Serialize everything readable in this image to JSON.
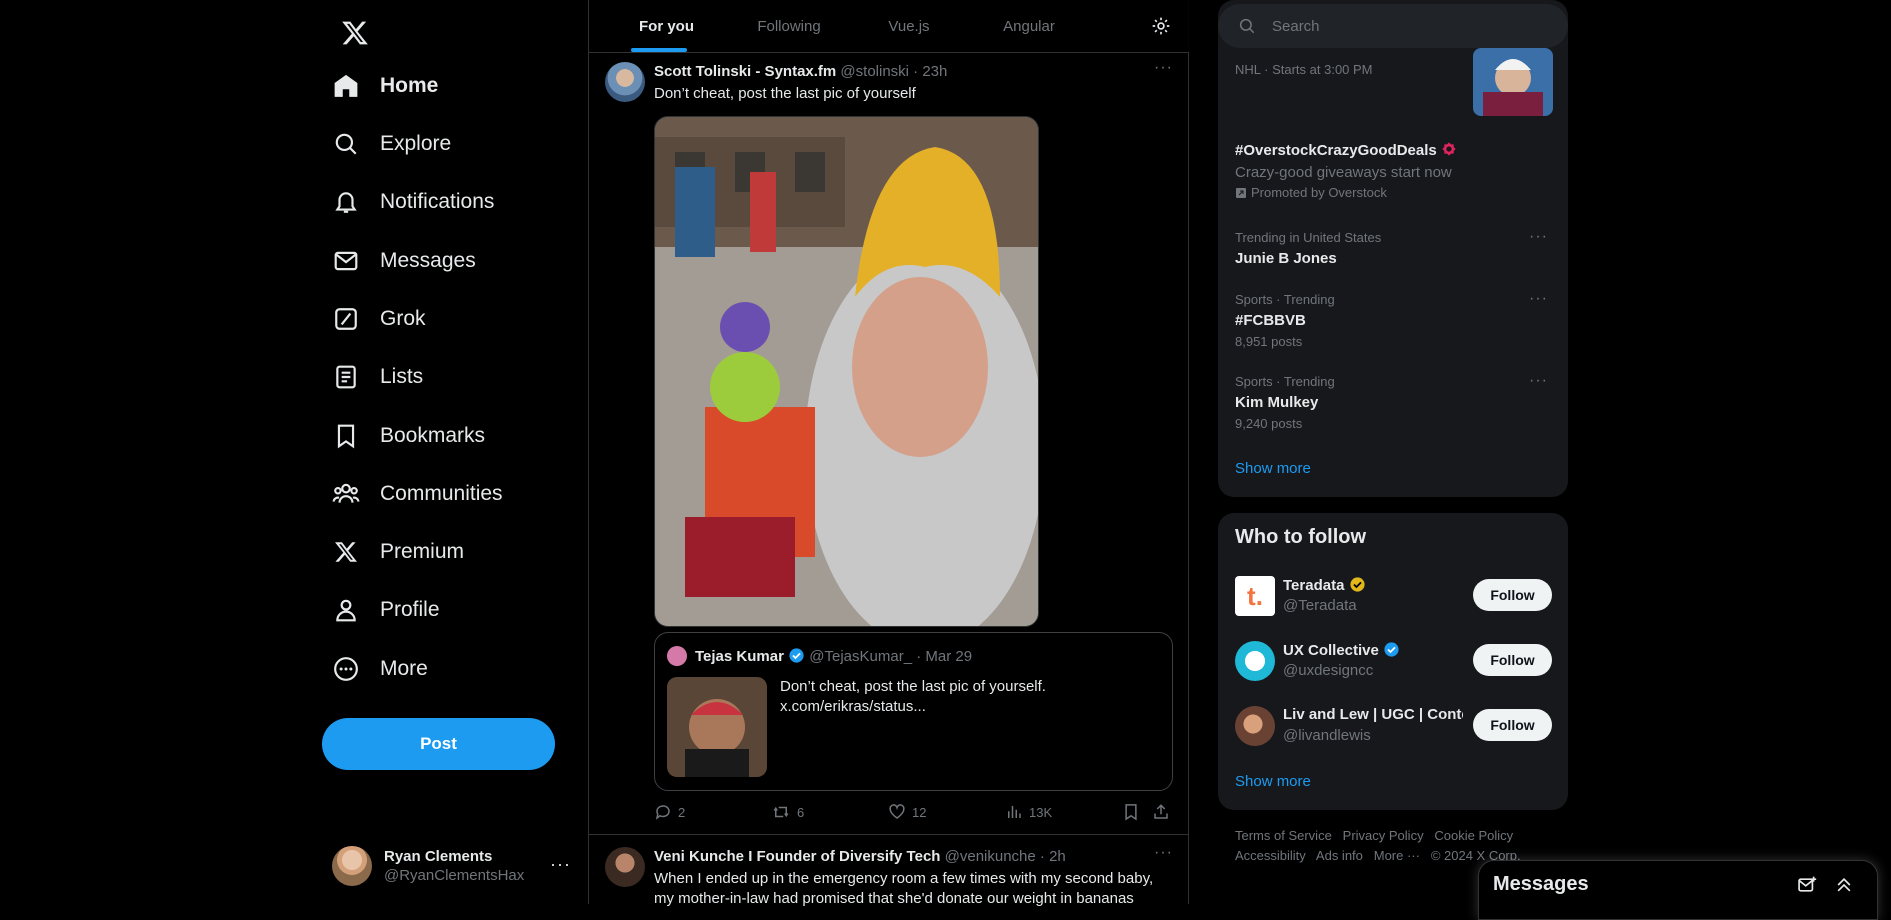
{
  "nav": {
    "items": [
      {
        "label": "Home",
        "icon": "home-icon",
        "active": true
      },
      {
        "label": "Explore",
        "icon": "search-icon"
      },
      {
        "label": "Notifications",
        "icon": "bell-icon"
      },
      {
        "label": "Messages",
        "icon": "envelope-icon"
      },
      {
        "label": "Grok",
        "icon": "grok-icon"
      },
      {
        "label": "Lists",
        "icon": "list-icon"
      },
      {
        "label": "Bookmarks",
        "icon": "bookmark-icon"
      },
      {
        "label": "Communities",
        "icon": "communities-icon"
      },
      {
        "label": "Premium",
        "icon": "x-logo-icon"
      },
      {
        "label": "Profile",
        "icon": "person-icon"
      },
      {
        "label": "More",
        "icon": "more-circle-icon"
      }
    ],
    "post_label": "Post",
    "account": {
      "name": "Ryan Clements",
      "handle": "@RyanClementsHax"
    }
  },
  "feed": {
    "tabs": [
      "For you",
      "Following",
      "Vue.js",
      "Angular"
    ],
    "active_tab": "For you",
    "tweets": [
      {
        "name": "Scott Tolinski - Syntax.fm",
        "handle": "@stolinski",
        "time": "· 23h",
        "text": "Don’t cheat, post the last pic of yourself",
        "quote": {
          "name": "Tejas Kumar",
          "handle": "@TejasKumar_",
          "time": "· Mar 29",
          "text_line1": "Don’t cheat, post the last pic of yourself.",
          "text_line2": "x.com/erikras/status..."
        },
        "actions": {
          "replies": "2",
          "reposts": "6",
          "likes": "12",
          "views": "13K"
        }
      },
      {
        "name": "Veni Kunche I Founder of Diversify Tech",
        "handle": "@venikunche",
        "time": "· 2h",
        "text_line1": "When I ended up in the emergency room a few times with my second baby,",
        "text_line2": "my mother-in-law had promised that she'd donate our weight in bananas"
      }
    ]
  },
  "right": {
    "search_placeholder": "Search",
    "trends": {
      "top_partial_meta": "NHL · Starts at 3:00 PM",
      "promoted": {
        "title": "#OverstockCrazyGoodDeals",
        "subtitle": "Crazy-good giveaways start now",
        "promoted_by": "Promoted by Overstock"
      },
      "items": [
        {
          "meta": "Trending in United States",
          "title": "Junie B Jones",
          "posts": ""
        },
        {
          "meta": "Sports · Trending",
          "title": "#FCBBVB",
          "posts": "8,951 posts"
        },
        {
          "meta": "Sports · Trending",
          "title": "Kim Mulkey",
          "posts": "9,240 posts"
        }
      ],
      "show_more": "Show more"
    },
    "who_to_follow": {
      "title": "Who to follow",
      "accounts": [
        {
          "name": "Teradata",
          "handle": "@Teradata",
          "badge": "gold"
        },
        {
          "name": "UX Collective",
          "handle": "@uxdesigncc",
          "badge": "blue"
        },
        {
          "name": "Liv and Lew | UGC | Conte",
          "handle": "@livandlewis",
          "badge": ""
        }
      ],
      "follow_label": "Follow",
      "show_more": "Show more"
    },
    "footer": {
      "line1": [
        "Terms of Service",
        "Privacy Policy",
        "Cookie Policy"
      ],
      "line2": [
        "Accessibility",
        "Ads info",
        "More ···",
        "© 2024 X Corp."
      ]
    }
  },
  "messages_drawer": {
    "title": "Messages"
  },
  "colors": {
    "accent": "#1d9bf0",
    "background": "#000000",
    "panel": "#16181c",
    "muted": "#71767b",
    "gold_badge": "#e2b719"
  }
}
